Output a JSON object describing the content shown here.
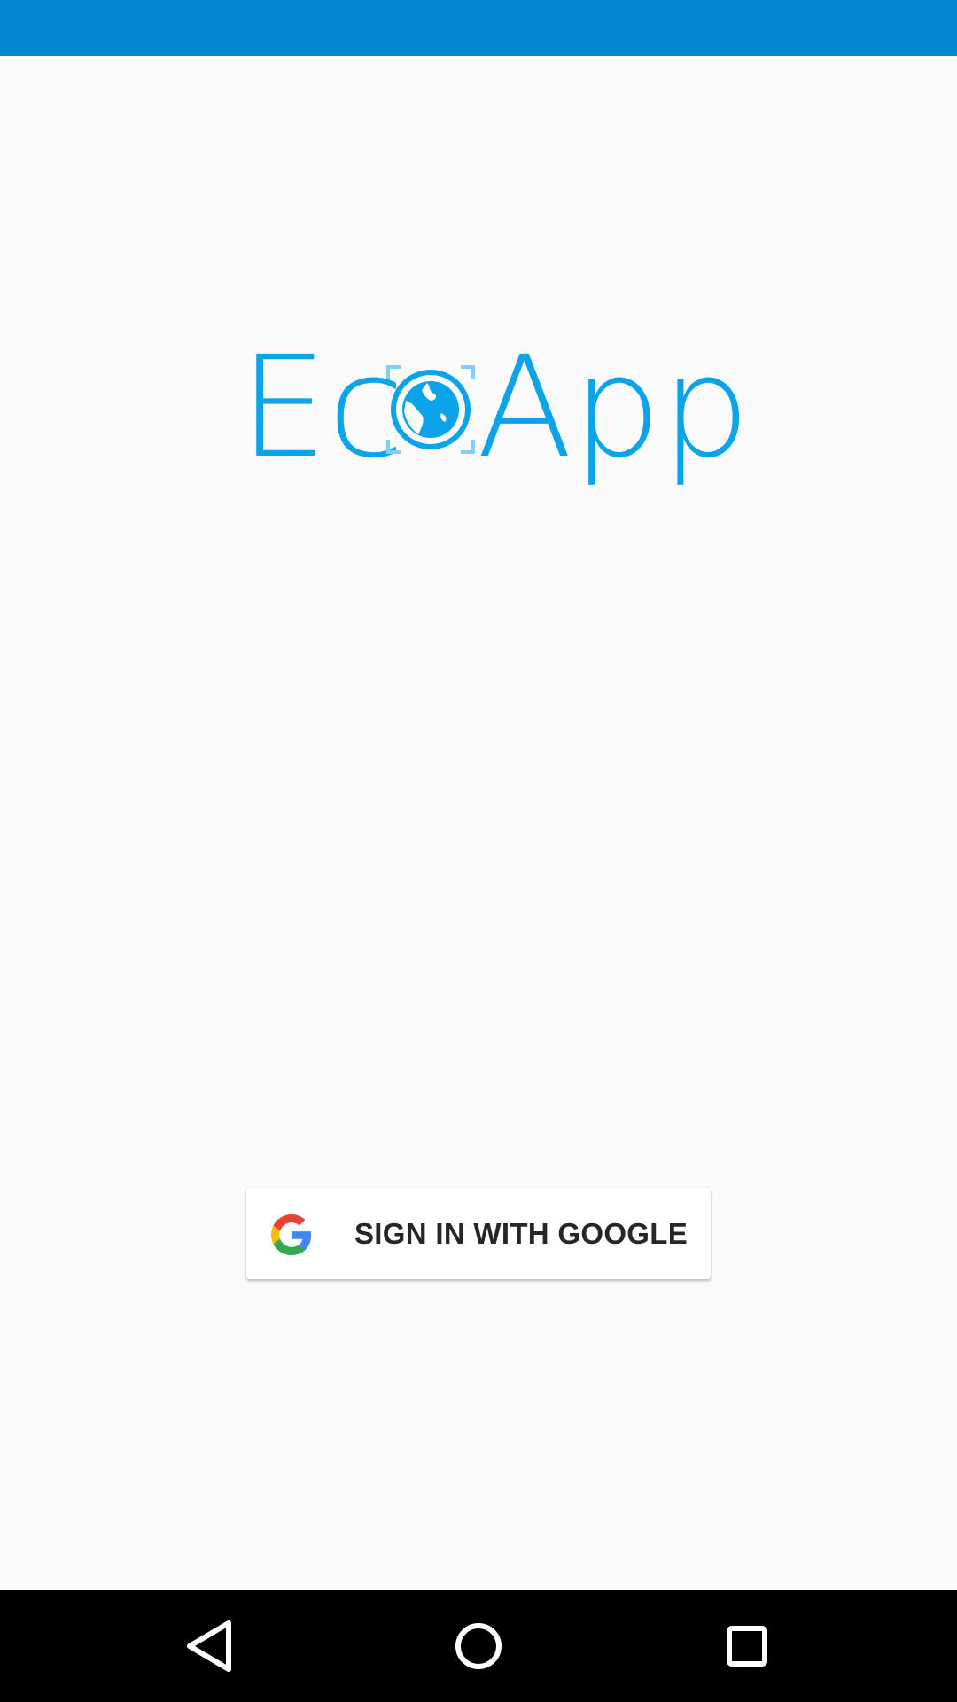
{
  "app": {
    "name_part_1": "Ec",
    "name_part_2": "App",
    "brand_color": "#0ba4ea",
    "logo_icon": "globe-icon"
  },
  "status_bar": {
    "color": "#0288d1"
  },
  "sign_in": {
    "label": "SIGN IN WITH GOOGLE",
    "icon": "google-g-icon"
  },
  "navigation": {
    "back_icon": "back-triangle-icon",
    "home_icon": "home-circle-icon",
    "recents_icon": "recents-square-icon"
  }
}
